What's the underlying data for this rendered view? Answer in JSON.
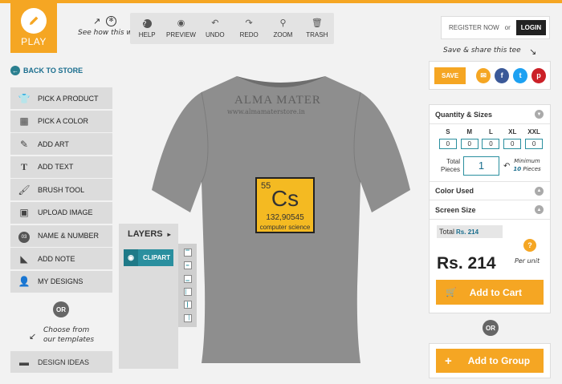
{
  "play": {
    "label": "PLAY"
  },
  "hints": {
    "how_works": "See how this works",
    "save_share": "Save & share this tee",
    "choose_templates_1": "Choose from",
    "choose_templates_2": "our templates"
  },
  "toolbar": {
    "items": [
      {
        "label": "HELP",
        "icon": "help-icon"
      },
      {
        "label": "PREVIEW",
        "icon": "eye-icon"
      },
      {
        "label": "UNDO",
        "icon": "undo-icon"
      },
      {
        "label": "REDO",
        "icon": "redo-icon"
      },
      {
        "label": "ZOOM",
        "icon": "zoom-icon"
      },
      {
        "label": "TRASH",
        "icon": "trash-icon"
      }
    ]
  },
  "nav": {
    "back": "BACK TO STORE"
  },
  "menu": {
    "items": [
      {
        "label": "PICK A PRODUCT",
        "icon": "tshirt-icon"
      },
      {
        "label": "PICK A COLOR",
        "icon": "palette-icon"
      },
      {
        "label": "ADD ART",
        "icon": "art-icon"
      },
      {
        "label": "ADD TEXT",
        "icon": "text-icon"
      },
      {
        "label": "BRUSH TOOL",
        "icon": "brush-icon"
      },
      {
        "label": "UPLOAD IMAGE",
        "icon": "image-icon"
      },
      {
        "label": "NAME & NUMBER",
        "icon": "number-badge-icon",
        "badge": "03"
      },
      {
        "label": "ADD NOTE",
        "icon": "note-icon"
      },
      {
        "label": "MY DESIGNS",
        "icon": "user-icon"
      }
    ],
    "or": "OR",
    "design_ideas": "DESIGN IDEAS"
  },
  "layers": {
    "title": "LAYERS",
    "items": [
      {
        "label": "CLIPART"
      }
    ]
  },
  "canvas": {
    "logo_text": "ALMA MATER",
    "logo_sub": "www.almamaterstore.in",
    "element": {
      "number": "55",
      "symbol": "Cs",
      "mass": "132,90545",
      "name": "computer science"
    },
    "shirt_color": "#8e8e8e"
  },
  "auth": {
    "register": "REGISTER NOW",
    "or": "or",
    "login": "LOGIN"
  },
  "social": {
    "save": "SAVE",
    "icons": [
      "email-icon",
      "facebook-icon",
      "twitter-icon",
      "pinterest-icon"
    ]
  },
  "order": {
    "quantity_title": "Quantity & Sizes",
    "sizes": [
      {
        "label": "S",
        "value": "0"
      },
      {
        "label": "M",
        "value": "0"
      },
      {
        "label": "L",
        "value": "0"
      },
      {
        "label": "XL",
        "value": "0"
      },
      {
        "label": "XXL",
        "value": "0"
      }
    ],
    "total_pieces_label_1": "Total",
    "total_pieces_label_2": "Pieces",
    "total_pieces_value": "1",
    "minimum_1": "Minimum",
    "minimum_num": "10",
    "minimum_2": "Pieces",
    "color_used_title": "Color Used",
    "screen_size_title": "Screen Size",
    "total_label": "Total",
    "total_value": "Rs. 214",
    "help": "?",
    "price": "Rs. 214",
    "per_unit": "Per unit",
    "add_to_cart": "Add to Cart"
  },
  "group": {
    "or": "OR",
    "add_to_group": "Add to Group"
  },
  "colors": {
    "accent": "#f5a623",
    "teal": "#2a8f9f",
    "facebook": "#3b5998",
    "twitter": "#1da1f2",
    "pinterest": "#cb2027"
  }
}
